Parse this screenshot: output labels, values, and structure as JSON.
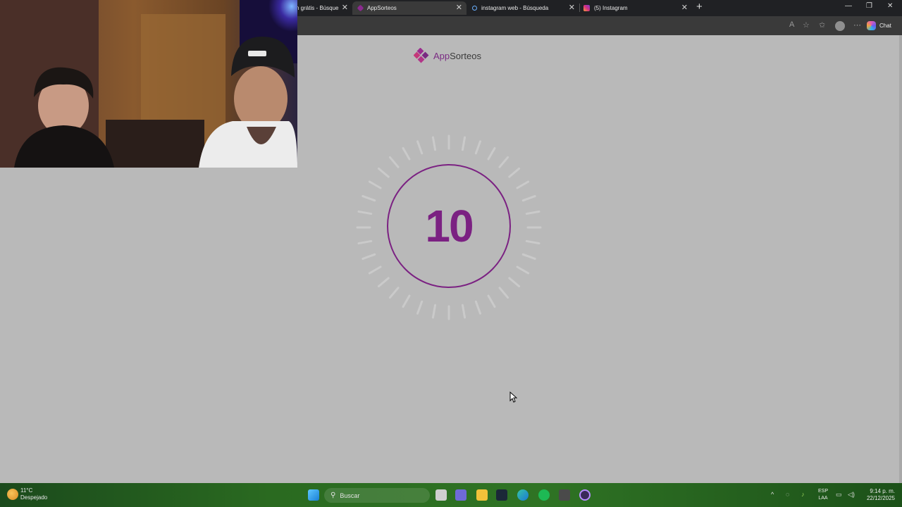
{
  "browser": {
    "tabs": [
      {
        "title": "n grátis - Búsque",
        "active": false
      },
      {
        "title": "AppSorteos",
        "active": true
      },
      {
        "title": "instagram web - Búsqueda",
        "active": false
      },
      {
        "title": "(5) Instagram",
        "active": false
      }
    ],
    "chat_label": "Chat"
  },
  "page": {
    "brand": {
      "prefix": "App",
      "suffix": "Sorteos"
    },
    "countdown": "10",
    "accent_color": "#7b2182"
  },
  "taskbar": {
    "weather": {
      "temp": "11°C",
      "condition": "Despejado"
    },
    "search_placeholder": "Buscar",
    "language": {
      "line1": "ESP",
      "line2": "LAA"
    },
    "clock": {
      "time": "9:14 p. m.",
      "date": "22/12/2025"
    }
  }
}
